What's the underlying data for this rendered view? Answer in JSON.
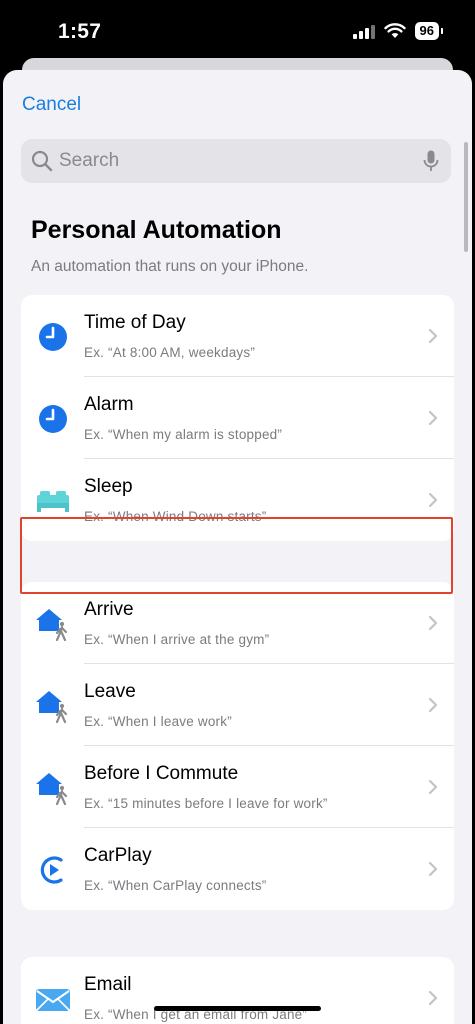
{
  "status_bar": {
    "time": "1:57",
    "battery": "96"
  },
  "header": {
    "cancel_label": "Cancel",
    "search_placeholder": "Search"
  },
  "page": {
    "title": "Personal Automation",
    "subtitle": "An automation that runs on your iPhone."
  },
  "groups": [
    {
      "items": [
        {
          "icon": "clock-icon",
          "title": "Time of Day",
          "subtitle": "Ex. “At 8:00 AM, weekdays”"
        },
        {
          "icon": "alarm-icon",
          "title": "Alarm",
          "subtitle": "Ex. “When my alarm is stopped”"
        },
        {
          "icon": "bed-icon",
          "title": "Sleep",
          "subtitle": "Ex. “When Wind Down starts”"
        }
      ]
    },
    {
      "items": [
        {
          "icon": "home-person-icon",
          "title": "Arrive",
          "subtitle": "Ex. “When I arrive at the gym”",
          "highlighted": true
        },
        {
          "icon": "home-person-icon",
          "title": "Leave",
          "subtitle": "Ex. “When I leave work”"
        },
        {
          "icon": "home-person-icon",
          "title": "Before I Commute",
          "subtitle": "Ex. “15 minutes before I leave for work”"
        },
        {
          "icon": "carplay-icon",
          "title": "CarPlay",
          "subtitle": "Ex. “When CarPlay connects”"
        }
      ]
    },
    {
      "items": [
        {
          "icon": "mail-icon",
          "title": "Email",
          "subtitle": "Ex. “When I get an email from Jane”"
        }
      ]
    }
  ],
  "colors": {
    "accent": "#1a7fe0",
    "icon_blue": "#1a73e8",
    "bed_teal": "#5ed3d8",
    "highlight_red": "#e0442c"
  }
}
